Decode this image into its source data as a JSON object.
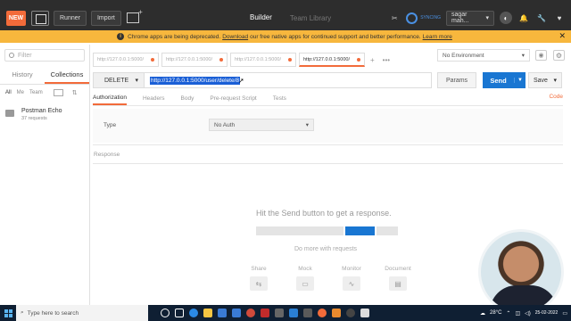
{
  "topbar": {
    "new_label": "NEW",
    "runner_label": "Runner",
    "import_label": "Import",
    "builder_label": "Builder",
    "library_label": "Team Library",
    "sync_label": "SYNCING",
    "user_label": "sagar mah..."
  },
  "banner": {
    "text_before": "Chrome apps are being deprecated.",
    "download_link": "Download",
    "text_after": "our free native apps for continued support and better performance.",
    "learn_more": "Learn more",
    "close": "✕"
  },
  "sidebar": {
    "filter_placeholder": "Filter",
    "tabs": [
      "History",
      "Collections"
    ],
    "sub": {
      "all": "All",
      "me": "Me",
      "team": "Team"
    },
    "collection": {
      "name": "Postman Echo",
      "count": "37 requests"
    }
  },
  "tabs": [
    {
      "label": "http://127.0.0.1:5000/"
    },
    {
      "label": "http://127.0.0.1:5000/"
    },
    {
      "label": "http://127.0.0.1:5000/"
    },
    {
      "label": "http://127.0.0.1:5000/"
    }
  ],
  "environment": "No Environment",
  "request": {
    "method": "DELETE",
    "url": "http://127.0.0.1:5000/user/delete/8",
    "params_label": "Params",
    "send_label": "Send",
    "save_label": "Save"
  },
  "subtabs": [
    "Authorization",
    "Headers",
    "Body",
    "Pre-request Script",
    "Tests"
  ],
  "code_label": "Code",
  "auth": {
    "type_label": "Type",
    "value": "No Auth"
  },
  "response": {
    "label": "Response",
    "empty_message": "Hit the Send button to get a response.",
    "more_label": "Do more with requests",
    "actions": [
      "Share",
      "Mock",
      "Monitor",
      "Document"
    ]
  },
  "taskbar": {
    "search_placeholder": "Type here to search",
    "temperature": "28°C",
    "date": "25-02-2022"
  },
  "colors": {
    "accent": "#f26b3a",
    "send_blue": "#1976d2",
    "banner": "#f7b73d",
    "topbar": "#2d2d2d"
  }
}
